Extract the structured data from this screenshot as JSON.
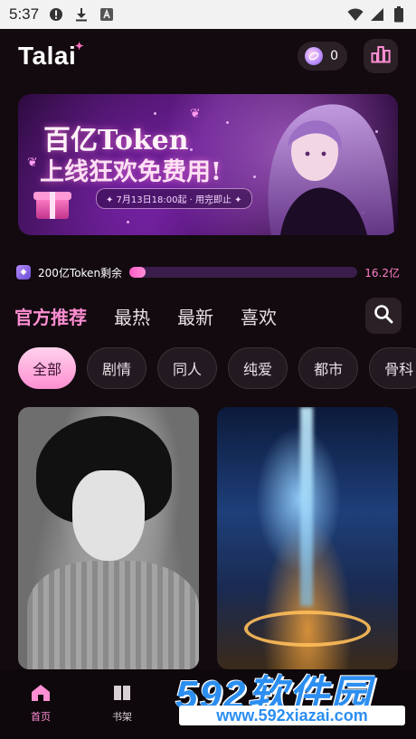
{
  "status_bar": {
    "time": "5:37",
    "icons": [
      "alert-icon",
      "download-icon",
      "font-icon",
      "wifi-icon",
      "signal-icon",
      "battery-icon"
    ]
  },
  "header": {
    "logo": "Talai",
    "token_count": "0",
    "icons": [
      "coin-icon",
      "ranking-icon"
    ]
  },
  "banner": {
    "title": "百亿Token",
    "subtitle": "上线狂欢免费用!",
    "date_text": "✦ 7月13日18:00起 · 用完即止 ✦"
  },
  "token_progress": {
    "label": "200亿Token剩余",
    "total": "16.2亿",
    "progress": 0.03
  },
  "tabs": [
    {
      "label": "官方推荐",
      "active": true
    },
    {
      "label": "最热",
      "active": false
    },
    {
      "label": "最新",
      "active": false
    },
    {
      "label": "喜欢",
      "active": false
    }
  ],
  "chips": [
    {
      "label": "全部",
      "active": true
    },
    {
      "label": "剧情",
      "active": false
    },
    {
      "label": "同人",
      "active": false
    },
    {
      "label": "纯爱",
      "active": false
    },
    {
      "label": "都市",
      "active": false
    },
    {
      "label": "骨科",
      "active": false
    }
  ],
  "bottom_nav": [
    {
      "label": "首页",
      "icon": "home-icon",
      "active": true
    },
    {
      "label": "书架",
      "icon": "bookshelf-icon",
      "active": false
    }
  ],
  "watermark": {
    "brand": "592软件园",
    "url": "www.592xiazai.com"
  },
  "colors": {
    "accent": "#ff8ed2",
    "background": "#120a0f",
    "progress_track": "#3a1d4a"
  }
}
